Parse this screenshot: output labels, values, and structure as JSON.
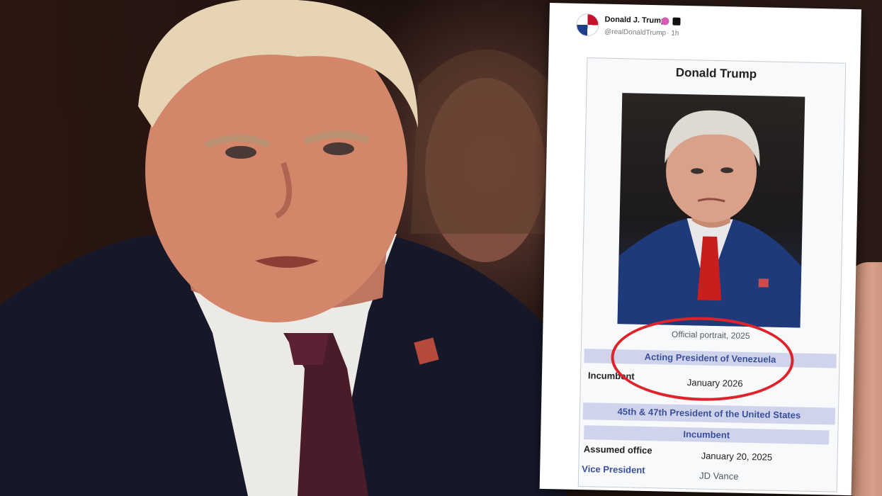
{
  "post": {
    "author_name": "Donald J. Trump",
    "author_handle": "@realDonaldTrump",
    "time": "· 1h"
  },
  "infobox": {
    "title": "Donald Trump",
    "caption": "Official portrait, 2025",
    "acting_office": "Acting President of Venezuela",
    "incumbent_label": "Incumbent",
    "incumbent_date": "January 2026",
    "office_main": "45th & 47th President of the United States",
    "incumbent_band": "Incumbent",
    "assumed_label": "Assumed office",
    "assumed_date": "January 20, 2025",
    "vp_label": "Vice President",
    "vp_value": "JD Vance"
  },
  "colors": {
    "highlight": "#e0222a",
    "infobox_band": "#cfd4ec",
    "link_blue": "#3a4f9c"
  }
}
